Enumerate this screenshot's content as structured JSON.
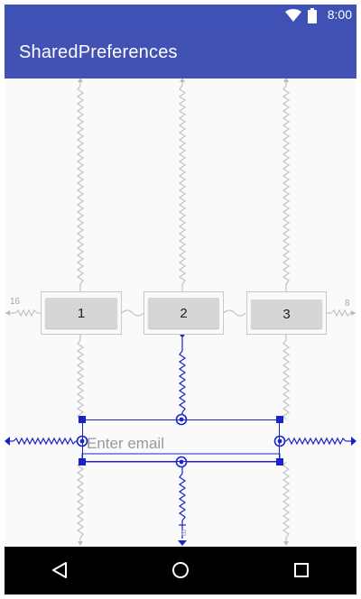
{
  "status_bar": {
    "time": "8:00",
    "icons": [
      "wifi-icon",
      "battery-icon"
    ]
  },
  "app_bar": {
    "title": "SharedPreferences"
  },
  "buttons": [
    {
      "label": "1"
    },
    {
      "label": "2"
    },
    {
      "label": "3"
    }
  ],
  "email": {
    "placeholder": "Enter email",
    "value": ""
  },
  "margins": {
    "left": "16",
    "right": "8",
    "bottom": "8"
  },
  "nav_bar": {
    "icons": [
      "back-icon",
      "home-icon",
      "recents-icon"
    ]
  },
  "colors": {
    "status_bar": "#3f51b5",
    "app_bar": "#4152b4",
    "selection": "#1a22c8",
    "constraint": "#c2c2c2"
  }
}
